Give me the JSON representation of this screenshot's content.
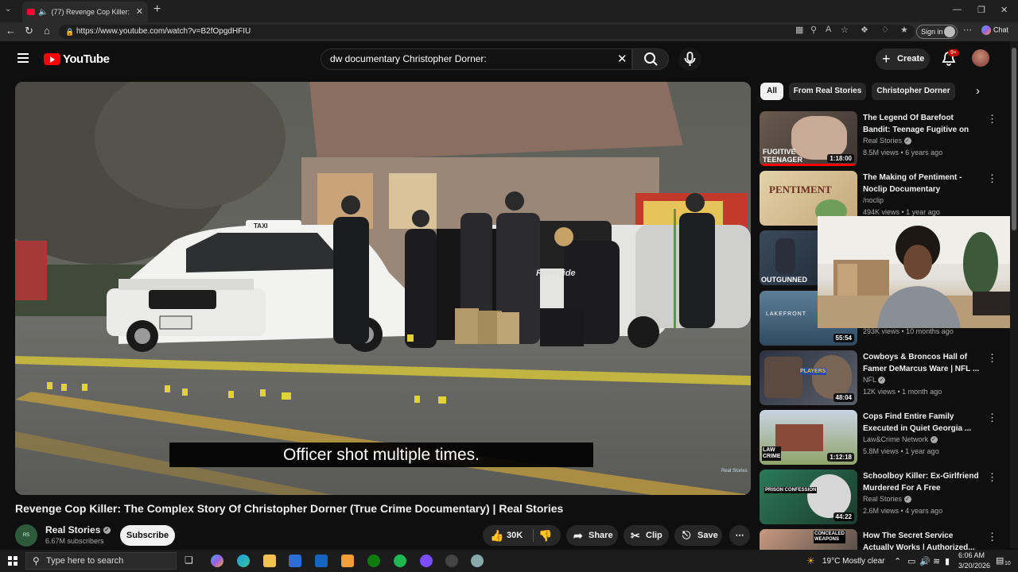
{
  "browser": {
    "tab_title": "(77) Revenge Cop Killer: The C",
    "url": "https://www.youtube.com/watch?v=B2fOpgdHFIU",
    "signin_label": "Sign in",
    "chat_label": "Chat"
  },
  "header": {
    "logo_text": "YouTube",
    "search_query": "dw documentary Christopher Dorner:",
    "create_label": "Create",
    "notif_badge": "9+"
  },
  "video": {
    "caption": "Officer shot multiple times.",
    "title": "Revenge Cop Killer: The Complex Story Of Christopher Dorner (True Crime Documentary) | Real Stories",
    "channel": "Real Stories",
    "subscribers": "6.67M subscribers",
    "subscribe_label": "Subscribe",
    "likes": "30K",
    "share_label": "Share",
    "clip_label": "Clip",
    "save_label": "Save",
    "taxi_sign": "TAXI",
    "car_text": "Riverside",
    "watermark": "Real Stories"
  },
  "chips": [
    "All",
    "From Real Stories",
    "Christopher Dorner"
  ],
  "recommendations": [
    {
      "title": "The Legend Of Barefoot Bandit: Teenage Fugitive on the Run",
      "channel": "Real Stories",
      "verified": true,
      "meta": "8.5M views • 6 years ago",
      "duration": "1:18:00",
      "thumb_text": "FUGITIVE TEENAGER"
    },
    {
      "title": "The Making of Pentiment - Noclip Documentary",
      "channel": "/noclip",
      "verified": false,
      "meta": "494K views • 1 year ago",
      "duration": "",
      "thumb_text": "PENTIMENT"
    },
    {
      "title": "",
      "channel": "",
      "verified": false,
      "meta": "",
      "duration": "",
      "thumb_text": "OUTGUNNED"
    },
    {
      "title": "",
      "channel": "",
      "verified": false,
      "meta": "293K views • 10 months ago",
      "duration": "55:54",
      "thumb_text": "LAKEFRONT"
    },
    {
      "title": "Cowboys & Broncos Hall of Famer DeMarcus Ware | NFL ...",
      "channel": "NFL",
      "verified": true,
      "meta": "12K views • 1 month ago",
      "duration": "48:04",
      "thumb_text": "PLAYERS"
    },
    {
      "title": "Cops Find Entire Family Executed in Quiet Georgia ...",
      "channel": "Law&Crime Network",
      "verified": true,
      "meta": "5.8M views • 1 year ago",
      "duration": "1:12:18",
      "thumb_text": "LAW CRIME"
    },
    {
      "title": "Schoolboy Killer: Ex-Girlfriend Murdered For A Free Breakfast...",
      "channel": "Real Stories",
      "verified": true,
      "meta": "2.6M views • 4 years ago",
      "duration": "44:22",
      "thumb_text": "PRISON CONFESSION"
    },
    {
      "title": "How The Secret Service Actually Works | Authorized...",
      "channel": "",
      "verified": false,
      "meta": "",
      "duration": "",
      "thumb_text": "CONCEALED WEAPONS"
    }
  ],
  "taskbar": {
    "search_placeholder": "Type here to search",
    "weather": "19°C  Mostly clear",
    "time": "6:06 AM",
    "date": "3/20/2026",
    "notif_count": "10"
  }
}
